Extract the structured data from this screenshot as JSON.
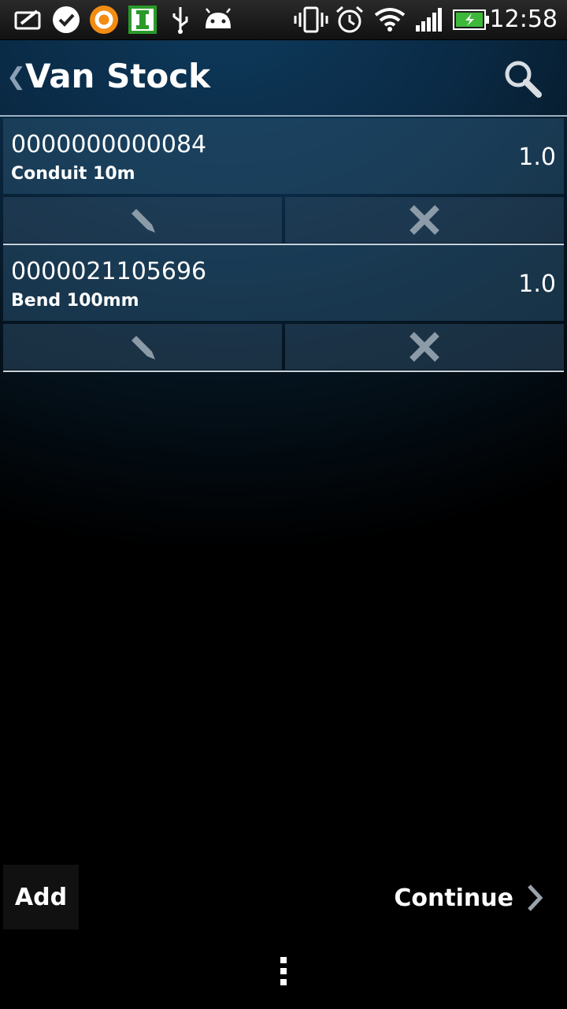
{
  "status_bar": {
    "time": "12:58",
    "left_icons": [
      "message-icon",
      "check-badge-icon",
      "orange-ring-app-icon",
      "green-i-app-icon",
      "usb-icon",
      "android-debug-icon"
    ],
    "right_icons": [
      "vibrate-icon",
      "alarm-clock-icon",
      "wifi-icon",
      "signal-icon",
      "battery-charging-icon"
    ],
    "colors": {
      "battery_fill": "#3db83b",
      "orange_app": "#f28c12",
      "green_app": "#2a9a2a"
    }
  },
  "action_bar": {
    "title": "Van Stock",
    "back_icon": "chevron-left-icon",
    "search_icon": "search-icon"
  },
  "items": [
    {
      "code": "0000000000084",
      "name": "Conduit 10m",
      "qty": "1.0"
    },
    {
      "code": "0000021105696",
      "name": "Bend 100mm",
      "qty": "1.0"
    }
  ],
  "item_actions": {
    "edit_icon": "pencil-icon",
    "delete_icon": "close-x-icon"
  },
  "bottom": {
    "add_label": "Add",
    "continue_label": "Continue",
    "continue_icon": "chevron-right-icon",
    "overflow_icon": "more-vert-icon"
  }
}
